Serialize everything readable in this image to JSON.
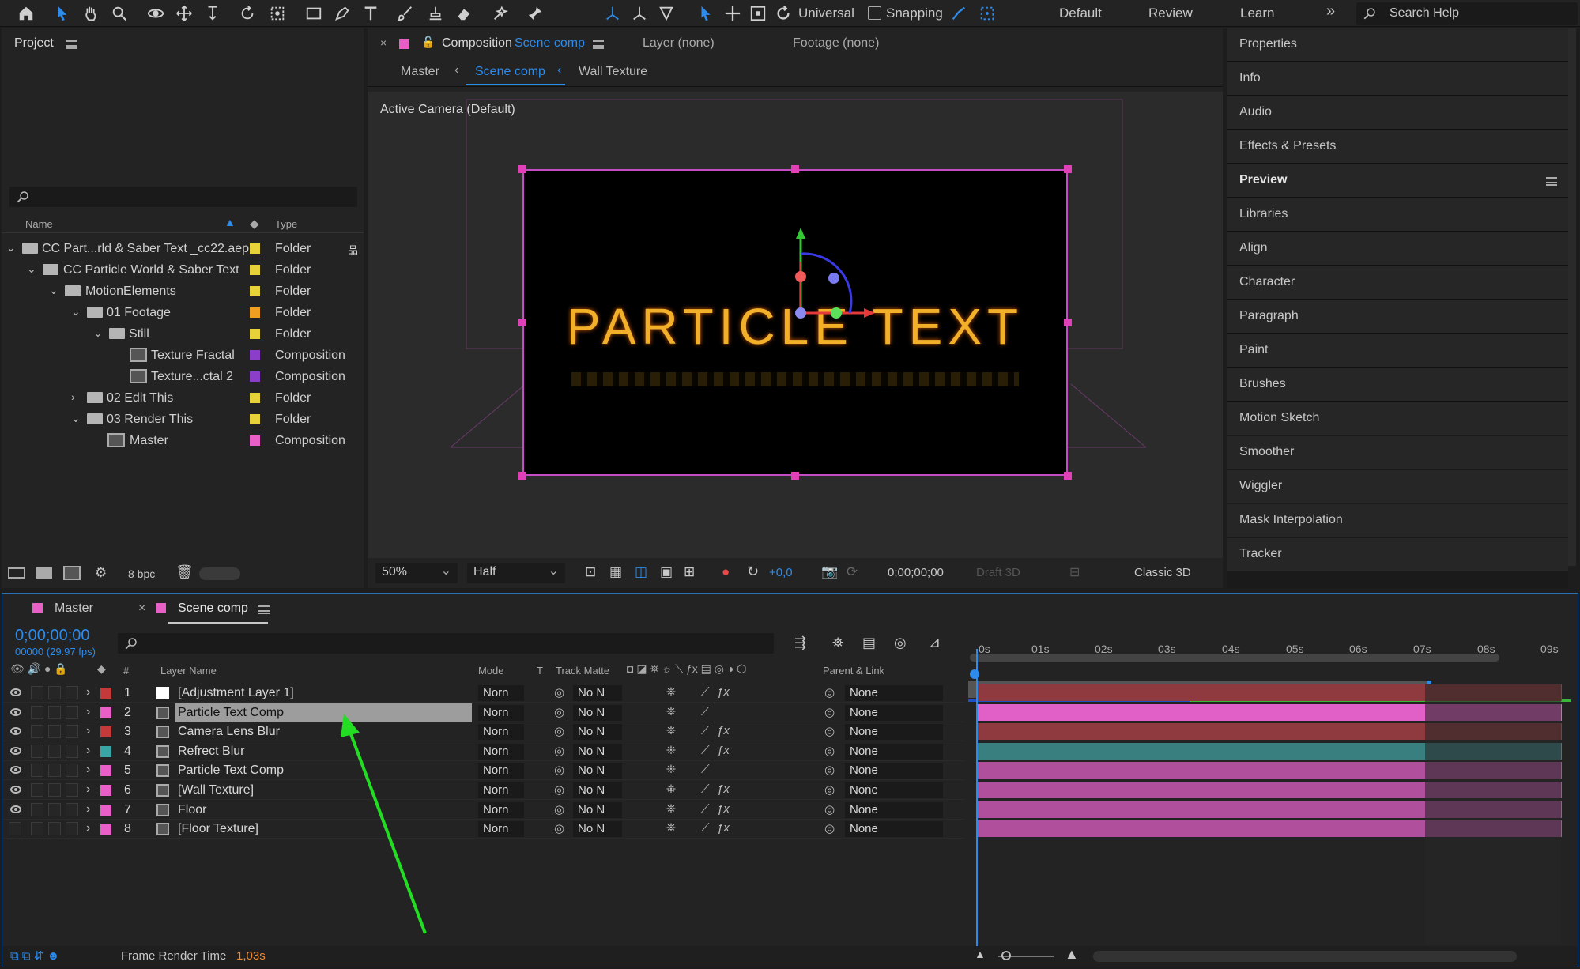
{
  "toolbar": {
    "universal_label": "Universal",
    "snapping_label": "Snapping",
    "workspaces": [
      "Default",
      "Review",
      "Learn"
    ],
    "more_label": "»",
    "search_placeholder": "Search Help"
  },
  "project": {
    "title": "Project",
    "col_name": "Name",
    "col_type": "Type",
    "bpc_label": "8 bpc",
    "rows": [
      {
        "name": "CC Part...rld & Saber Text _cc22.aep",
        "type": "Folder",
        "label_color": "#e8d23a"
      },
      {
        "name": "CC Particle World & Saber Text",
        "type": "Folder",
        "label_color": "#e8d23a"
      },
      {
        "name": "MotionElements",
        "type": "Folder",
        "label_color": "#e8d23a"
      },
      {
        "name": "01 Footage",
        "type": "Folder",
        "label_color": "#f0a020"
      },
      {
        "name": "Still",
        "type": "Folder",
        "label_color": "#e8d23a"
      },
      {
        "name": "Texture Fractal",
        "type": "Composition",
        "label_color": "#8b3ec8"
      },
      {
        "name": "Texture...ctal 2",
        "type": "Composition",
        "label_color": "#8b3ec8"
      },
      {
        "name": "02 Edit This",
        "type": "Folder",
        "label_color": "#e8d23a"
      },
      {
        "name": "03 Render This",
        "type": "Folder",
        "label_color": "#e8d23a"
      },
      {
        "name": "Master",
        "type": "Composition",
        "label_color": "#e85fc8"
      }
    ]
  },
  "comp": {
    "tab_label": "Composition",
    "tab_comp_name": "Scene comp",
    "layer_tab": "Layer (none)",
    "footage_tab": "Footage (none)",
    "breadcrumbs": [
      "Master",
      "Scene comp",
      "Wall Texture"
    ],
    "camera_label": "Active Camera (Default)",
    "canvas_text": "PARTICLE TEXT",
    "zoom": "50%",
    "resolution": "Half",
    "exposure": "+0,0",
    "timecode": "0;00;00;00",
    "draft3d": "Draft 3D",
    "renderer": "Classic 3D"
  },
  "right_panels": [
    "Properties",
    "Info",
    "Audio",
    "Effects & Presets",
    "Preview",
    "Libraries",
    "Align",
    "Character",
    "Paragraph",
    "Paint",
    "Brushes",
    "Motion Sketch",
    "Smoother",
    "Wiggler",
    "Mask Interpolation",
    "Tracker"
  ],
  "timeline": {
    "tabs": [
      "Master",
      "Scene comp"
    ],
    "timecode": "0;00;00;00",
    "fps_label": "00000 (29.97 fps)",
    "headers": {
      "num": "#",
      "layer_name": "Layer Name",
      "mode": "Mode",
      "t": "T",
      "track_matte": "Track Matte",
      "parent": "Parent & Link"
    },
    "ruler_ticks": [
      "0s",
      "01s",
      "02s",
      "03s",
      "04s",
      "05s",
      "06s",
      "07s",
      "08s",
      "09s"
    ],
    "layers": [
      {
        "num": "1",
        "name": "[Adjustment Layer 1]",
        "mode": "Norn",
        "matte": "No N",
        "parent": "None",
        "label_color": "#c43a3a",
        "bar_color": "#8f3a3f",
        "visible": true
      },
      {
        "num": "2",
        "name": "Particle Text Comp",
        "mode": "Norn",
        "matte": "No N",
        "parent": "None",
        "label_color": "#e85fc8",
        "bar_color": "#e060c8",
        "visible": true
      },
      {
        "num": "3",
        "name": "Camera Lens Blur",
        "mode": "Norn",
        "matte": "No N",
        "parent": "None",
        "label_color": "#c43a3a",
        "bar_color": "#8f3a3f",
        "visible": true
      },
      {
        "num": "4",
        "name": "Refrect Blur",
        "mode": "Norn",
        "matte": "No N",
        "parent": "None",
        "label_color": "#3aa5a5",
        "bar_color": "#3a7f80",
        "visible": true
      },
      {
        "num": "5",
        "name": "Particle Text Comp",
        "mode": "Norn",
        "matte": "No N",
        "parent": "None",
        "label_color": "#e85fc8",
        "bar_color": "#b0509c",
        "visible": true
      },
      {
        "num": "6",
        "name": "[Wall Texture]",
        "mode": "Norn",
        "matte": "No N",
        "parent": "None",
        "label_color": "#e85fc8",
        "bar_color": "#b0509c",
        "visible": true
      },
      {
        "num": "7",
        "name": "Floor",
        "mode": "Norn",
        "matte": "No N",
        "parent": "None",
        "label_color": "#e85fc8",
        "bar_color": "#b0509c",
        "visible": true
      },
      {
        "num": "8",
        "name": "[Floor Texture]",
        "mode": "Norn",
        "matte": "No N",
        "parent": "None",
        "label_color": "#e85fc8",
        "bar_color": "#b0509c",
        "visible": false
      }
    ],
    "footer_label": "Frame Render Time",
    "footer_value": "1,03s"
  },
  "colors": {
    "accent": "#2d8ceb",
    "annotation_arrow": "#22dd22"
  }
}
